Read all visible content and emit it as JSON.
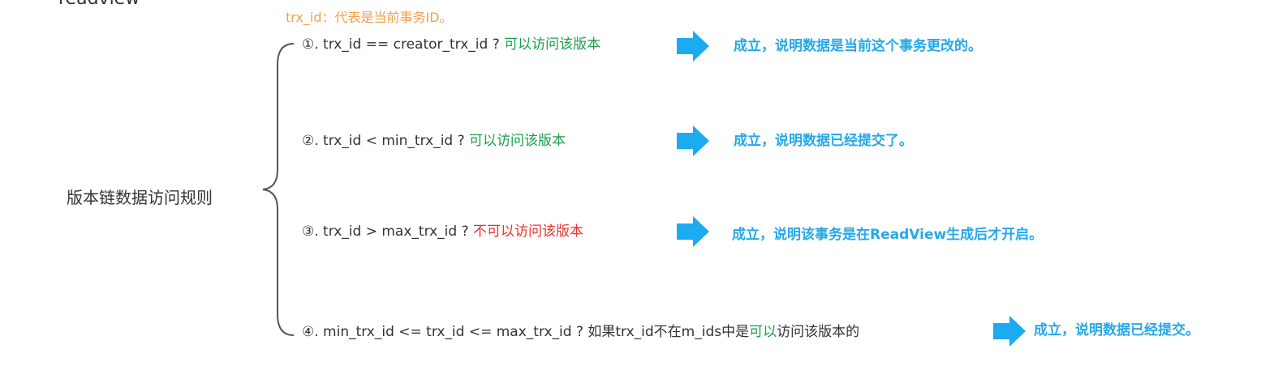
{
  "heading_fragment": "readview",
  "note": "trx_id：代表是当前事务ID。",
  "main_label": "版本链数据访问规则",
  "colors": {
    "note": "#f0a04b",
    "green": "#1a9e4b",
    "red": "#e8332a",
    "arrow": "#1aabf0",
    "result": "#25a9e8",
    "brace": "#555555"
  },
  "rules": [
    {
      "prefix": "①. trx_id  == creator_trx_id ? ",
      "highlight": "可以访问该版本",
      "highlight_color": "green",
      "suffix": "",
      "result": "成立，说明数据是当前这个事务更改的。",
      "arrow_icon": "arrow-right-icon"
    },
    {
      "prefix": "②. trx_id < min_trx_id ? ",
      "highlight": "可以访问该版本",
      "highlight_color": "green",
      "suffix": "",
      "result": "成立，说明数据已经提交了。",
      "arrow_icon": "arrow-right-icon"
    },
    {
      "prefix": "③. trx_id > max_trx_id ?  ",
      "highlight": "不可以访问该版本",
      "highlight_color": "red",
      "suffix": "",
      "result": "成立，说明该事务是在ReadView生成后才开启。",
      "arrow_icon": "arrow-right-icon"
    },
    {
      "prefix": "④. min_trx_id <= trx_id <= max_trx_id ?  如果trx_id不在m_ids中是",
      "highlight": "可以",
      "highlight_color": "green",
      "suffix": "访问该版本的",
      "result": "成立，说明数据已经提交。",
      "arrow_icon": "arrow-right-icon"
    }
  ]
}
